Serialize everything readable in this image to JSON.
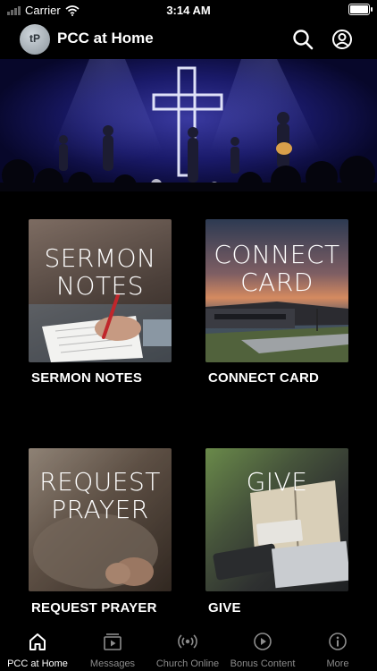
{
  "status": {
    "carrier": "Carrier",
    "time": "3:14 AM"
  },
  "header": {
    "logo_text": "tP",
    "title": "PCC at Home"
  },
  "tiles": [
    {
      "image_text": [
        "SERMON",
        "NOTES"
      ],
      "label": "SERMON NOTES"
    },
    {
      "image_text": [
        "CONNECT",
        "CARD"
      ],
      "label": "CONNECT CARD"
    },
    {
      "image_text": [
        "REQUEST",
        "PRAYER"
      ],
      "label": "REQUEST PRAYER"
    },
    {
      "image_text": [
        "GIVE"
      ],
      "label": "GIVE"
    }
  ],
  "tabs": [
    {
      "label": "PCC at Home",
      "icon": "home-icon",
      "active": true
    },
    {
      "label": "Messages",
      "icon": "play-screen-icon",
      "active": false
    },
    {
      "label": "Church Online",
      "icon": "broadcast-icon",
      "active": false
    },
    {
      "label": "Bonus Content",
      "icon": "play-circle-icon",
      "active": false
    },
    {
      "label": "More",
      "icon": "info-icon",
      "active": false
    }
  ],
  "colors": {
    "background": "#000000",
    "tab_inactive": "#8c8c8c",
    "tab_active": "#ffffff"
  }
}
